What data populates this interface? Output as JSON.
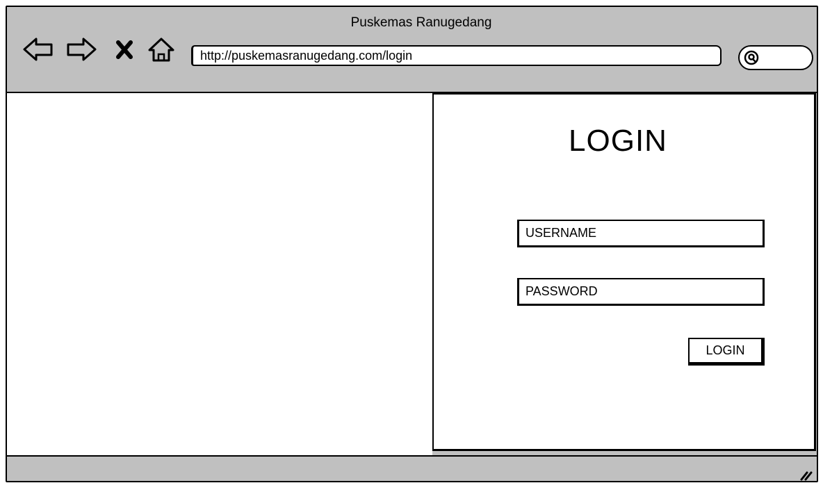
{
  "window": {
    "title": "Puskemas Ranugedang"
  },
  "toolbar": {
    "back_icon": "back-arrow-icon",
    "forward_icon": "forward-arrow-icon",
    "stop_icon": "close-x-icon",
    "home_icon": "home-icon",
    "url": "http://puskemasranugedang.com/login",
    "search_icon": "search-icon"
  },
  "login": {
    "heading": "LOGIN",
    "username_placeholder": "USERNAME",
    "password_placeholder": "PASSWORD",
    "button_label": "LOGIN"
  },
  "statusbar": {
    "grip_icon": "resize-grip-icon"
  }
}
